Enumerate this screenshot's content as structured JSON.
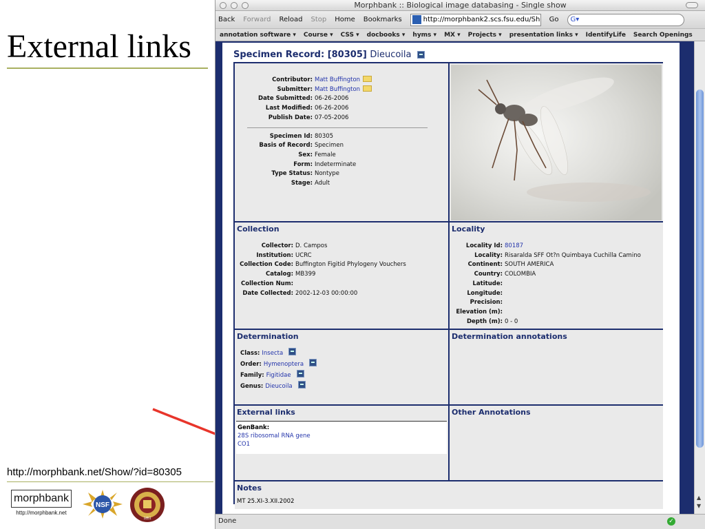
{
  "slide": {
    "title": "External links",
    "url_caption": "http://morphbank.net/Show/?id=80305",
    "logos": {
      "morphbank": "morphbank",
      "morphbank_sub": "http://morphbank.net",
      "nsf": "NSF",
      "fsu_year": "1851"
    }
  },
  "browser": {
    "window_title": "Morphbank :: Biological image databasing - Single show",
    "toolbar": {
      "back": "Back",
      "forward": "Forward",
      "reload": "Reload",
      "stop": "Stop",
      "home": "Home",
      "bookmarks": "Bookmarks",
      "url": "http://morphbank2.scs.fsu.edu/Show",
      "go": "Go",
      "search": "G▾"
    },
    "bookmarks": [
      "annotation software ▾",
      "Course ▾",
      "CSS ▾",
      "docbooks ▾",
      "hyms ▾",
      "MX ▾",
      "Projects ▾",
      "presentation links ▾",
      "IdentifyLife",
      "Search Openings"
    ],
    "status": "Done"
  },
  "record": {
    "title": "Specimen Record: [80305]",
    "genus": "Dieucoila",
    "meta": [
      {
        "k": "Contributor:",
        "v": "Matt Buffington",
        "link": true,
        "mail": true
      },
      {
        "k": "Submitter:",
        "v": "Matt Buffington",
        "link": true,
        "mail": true
      },
      {
        "k": "Date Submitted:",
        "v": "06-26-2006"
      },
      {
        "k": "Last Modified:",
        "v": "06-26-2006"
      },
      {
        "k": "Publish Date:",
        "v": "07-05-2006"
      }
    ],
    "specimen": [
      {
        "k": "Specimen Id:",
        "v": "80305"
      },
      {
        "k": "Basis of Record:",
        "v": "Specimen"
      },
      {
        "k": "Sex:",
        "v": "Female"
      },
      {
        "k": "Form:",
        "v": "Indeterminate"
      },
      {
        "k": "Type Status:",
        "v": "Nontype"
      },
      {
        "k": "Stage:",
        "v": "Adult"
      }
    ],
    "collection": {
      "heading": "Collection",
      "rows": [
        {
          "k": "Collector:",
          "v": "D. Campos"
        },
        {
          "k": "Institution:",
          "v": "UCRC"
        },
        {
          "k": "Collection Code:",
          "v": "Buffington Figitid Phylogeny Vouchers"
        },
        {
          "k": "Catalog:",
          "v": "MB399"
        },
        {
          "k": "Collection Num:",
          "v": ""
        },
        {
          "k": "Date Collected:",
          "v": "2002-12-03 00:00:00"
        }
      ]
    },
    "locality": {
      "heading": "Locality",
      "rows": [
        {
          "k": "Locality Id:",
          "v": "80187",
          "link": true
        },
        {
          "k": "Locality:",
          "v": "Risaralda SFF Ot?n Quimbaya Cuchilla Camino"
        },
        {
          "k": "Continent:",
          "v": "SOUTH AMERICA"
        },
        {
          "k": "Country:",
          "v": "COLOMBIA"
        },
        {
          "k": "Latitude:",
          "v": ""
        },
        {
          "k": "Longitude:",
          "v": ""
        },
        {
          "k": "Precision:",
          "v": ""
        },
        {
          "k": "Elevation (m):",
          "v": ""
        },
        {
          "k": "Depth (m):",
          "v": "0  -  0"
        }
      ]
    },
    "determination": {
      "heading": "Determination",
      "rows": [
        {
          "k": "Class:",
          "v": "Insecta"
        },
        {
          "k": "Order:",
          "v": "Hymenoptera"
        },
        {
          "k": "Family:",
          "v": "Figitidae"
        },
        {
          "k": "Genus:",
          "v": "Dieucoila"
        }
      ]
    },
    "determination_annotations": {
      "heading": "Determination annotations"
    },
    "external_links": {
      "heading": "External links",
      "label": "GenBank:",
      "links": [
        "28S ribosomal RNA gene",
        "CO1"
      ]
    },
    "other_annotations": {
      "heading": "Other Annotations"
    },
    "notes": {
      "heading": "Notes",
      "text": "MT 25.XI-3.XII.2002"
    }
  },
  "colors": {
    "accent": "#1c2d6e",
    "link": "#2233aa",
    "arrow": "#e8352b"
  }
}
